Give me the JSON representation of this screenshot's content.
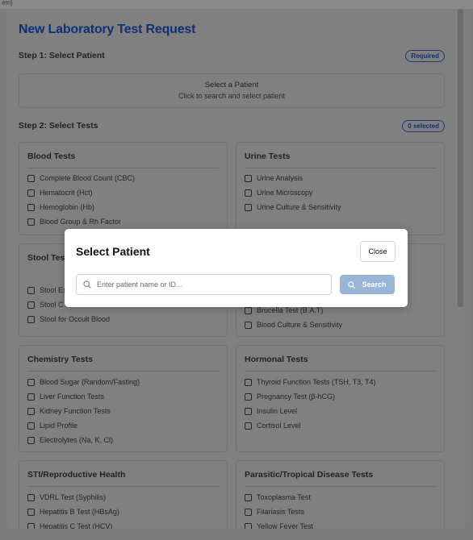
{
  "page_top_text": "em)",
  "form": {
    "title": "New Laboratory Test Request",
    "step1": {
      "label": "Step 1: Select Patient",
      "badge": "Required"
    },
    "patient_box": {
      "title": "Select a Patient",
      "subtitle": "Click to search and select patient"
    },
    "step2": {
      "label": "Step 2: Select Tests",
      "badge": "0 selected"
    },
    "cards": [
      {
        "title": "Blood Tests",
        "items": [
          "Complete Blood Count (CBC)",
          "Hematocrit (Hct)",
          "Hemoglobin (Hb)",
          "Blood Group & Rh Factor"
        ]
      },
      {
        "title": "Urine Tests",
        "items": [
          "Urine Analysis",
          "Urine Microscopy",
          "Urine Culture & Sensitivity"
        ]
      },
      {
        "title": "Stool Tests",
        "items": [
          "Stool Ex",
          "Stool C",
          "Stool for Occult Blood"
        ]
      },
      {
        "title": "",
        "items": [
          "Brucella Test (B.A.T)",
          "Blood Culture & Sensitivity"
        ]
      },
      {
        "title": "Chemistry Tests",
        "items": [
          "Blood Sugar (Random/Fasting)",
          "Liver Function Tests",
          "Kidney Function Tests",
          "Lipid Profile",
          "Electrolytes (Na, K, Cl)"
        ]
      },
      {
        "title": "Hormonal Tests",
        "items": [
          "Thyroid Function Tests (TSH, T3, T4)",
          "Pregnancy Test (β-hCG)",
          "Insulin Level",
          "Cortisol Level"
        ]
      },
      {
        "title": "STI/Reproductive Health",
        "items": [
          "VDRL Test (Syphilis)",
          "Hepatitis B Test (HBsAg)",
          "Hepatitis C Test (HCV)"
        ]
      },
      {
        "title": "Parasitic/Tropical Disease Tests",
        "items": [
          "Toxoplasma Test",
          "Filariasis Tests",
          "Yellow Fever Test"
        ]
      }
    ]
  },
  "modal": {
    "title": "Select Patient",
    "close_label": "Close",
    "search_placeholder": "Enter patient name or ID...",
    "search_value": "",
    "search_button_label": "Search"
  },
  "colors": {
    "accent": "#1a56db",
    "search_button": "#99b5d6",
    "overlay": "#808080"
  },
  "icons": {
    "search": "search-icon"
  }
}
